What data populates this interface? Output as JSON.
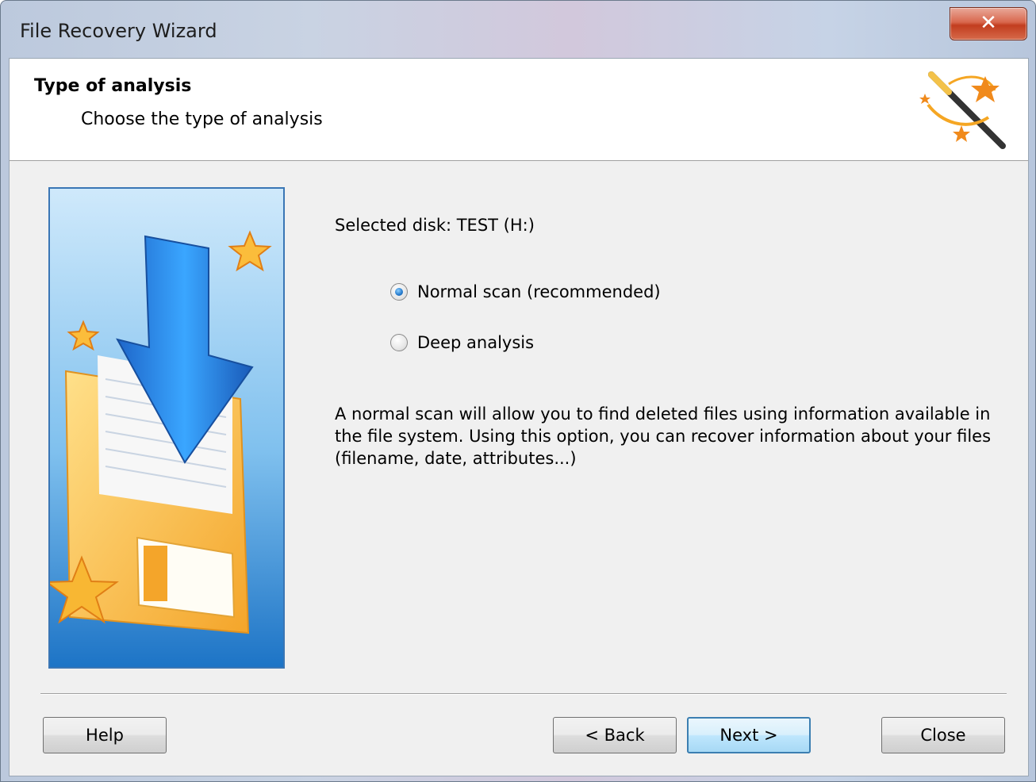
{
  "window": {
    "title": "File Recovery Wizard",
    "close_glyph": "✕"
  },
  "header": {
    "title": "Type of analysis",
    "subtitle": "Choose the type of analysis"
  },
  "main": {
    "selected_disk": "Selected disk: TEST (H:)",
    "options": [
      {
        "label": "Normal scan (recommended)",
        "selected": true
      },
      {
        "label": "Deep analysis",
        "selected": false
      }
    ],
    "description": "A normal scan will allow you to find deleted files using information available in the file system. Using this option, you can recover information about your files (filename, date, attributes...)"
  },
  "buttons": {
    "help": "Help",
    "back": "< Back",
    "next": "Next >",
    "close": "Close"
  },
  "icons": {
    "header_icon": "magic-wand-icon",
    "side_illustration": "floppy-download-illustration"
  },
  "colors": {
    "accent_blue": "#3c7fb1",
    "close_red": "#c23d1f",
    "star_orange": "#f5a623"
  }
}
